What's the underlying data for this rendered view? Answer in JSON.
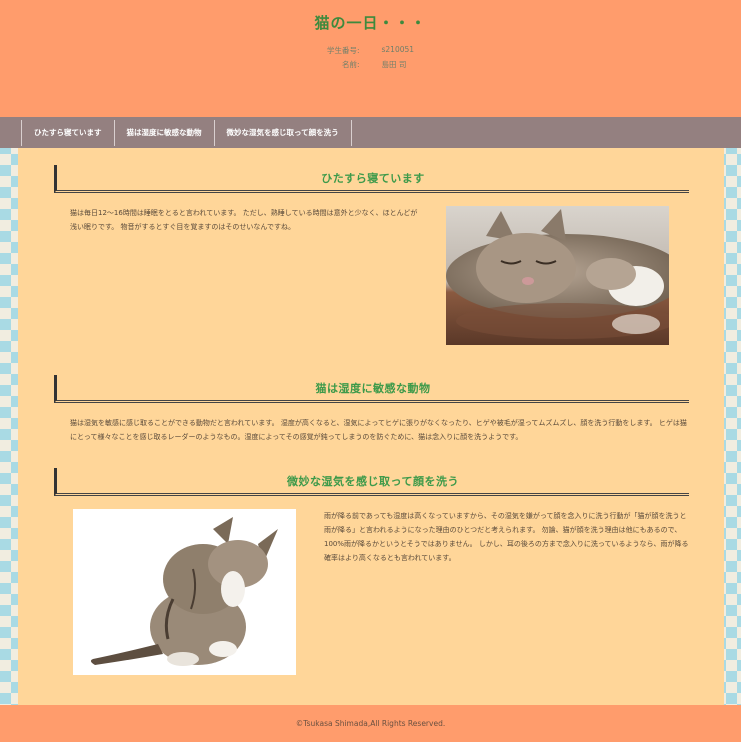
{
  "header": {
    "title": "猫の一日・・・",
    "student_id_label": "学生番号:",
    "student_id_value": "s210051",
    "name_label": "名前:",
    "name_value": "島田 司"
  },
  "nav": {
    "items": [
      {
        "label": "ひたすら寝ています"
      },
      {
        "label": "猫は湿度に敏感な動物"
      },
      {
        "label": "微妙な湿気を感じ取って顔を洗う"
      }
    ]
  },
  "sections": [
    {
      "title": "ひたすら寝ています",
      "text": "猫は毎日12〜16時間は睡眠をとると言われています。 ただし、熟睡している時間は意外と少なく、ほとんどが浅い眠りです。 物音がするとすぐ目を覚ますのはそのせいなんですね。"
    },
    {
      "title": "猫は湿度に敏感な動物",
      "text": "猫は湿気を敏感に感じ取ることができる動物だと言われています。 湿度が高くなると、湿気によってヒゲに張りがなくなったり、ヒゲや被毛が湿ってムズムズし、顔を洗う行動をします。 ヒゲは猫にとって様々なことを感じ取るレーダーのようなもの。湿度によってその感覚が鈍ってしまうのを防ぐために、猫は念入りに顔を洗うようです。"
    },
    {
      "title": "微妙な湿気を感じ取って顔を洗う",
      "text": "雨が降る前であっても湿度は高くなっていますから、その湿気を嫌がって顔を念入りに洗う行動が「猫が顔を洗うと雨が降る」と言われるようになった理由のひとつだと考えられます。 勿論、猫が顔を洗う理由は他にもあるので、100%雨が降るかというとそうではありません。 しかし、耳の後ろの方まで念入りに洗っているようなら、雨が降る確率はより高くなるとも言われています。"
    }
  ],
  "footer": {
    "copyright": "©Tsukasa Shimada,All Rights Reserved."
  }
}
